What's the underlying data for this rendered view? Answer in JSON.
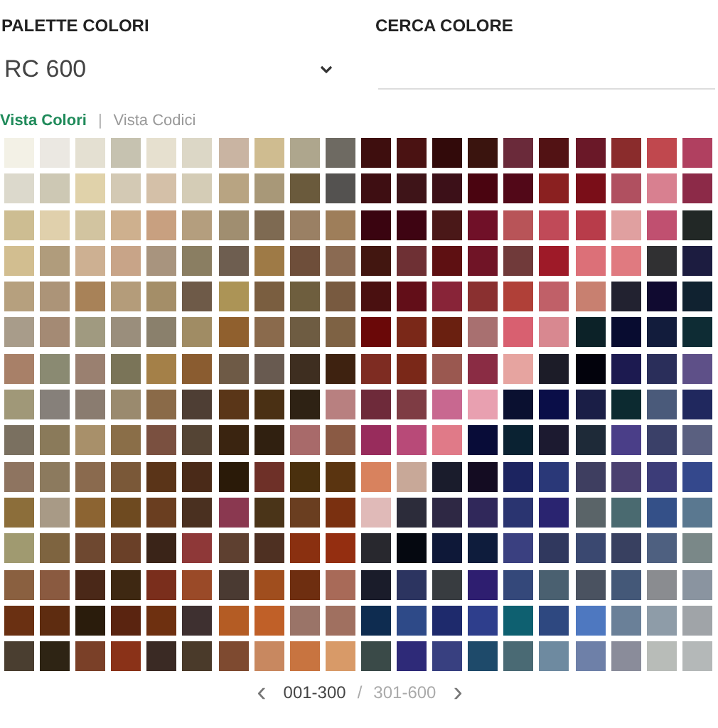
{
  "palette": {
    "label": "PALETTE COLORI",
    "value": "RC 600"
  },
  "search": {
    "label": "CERCA COLORE"
  },
  "views": [
    {
      "label": "Vista Colori",
      "selected": true
    },
    {
      "label": "Vista Codici",
      "selected": false
    }
  ],
  "view_separator": "|",
  "rows": [
    {
      "swatches": [
        {
          "color": "#f3f1e6"
        },
        {
          "color": "#ebe8e2"
        },
        {
          "color": "#e4e0d2"
        },
        {
          "color": "#c6c2b0"
        },
        {
          "color": "#e6e0cf"
        },
        {
          "color": "#dcd7c6"
        },
        {
          "color": "#c9b4a2"
        },
        {
          "color": "#cfbc90"
        },
        {
          "color": "#aea68d"
        },
        {
          "color": "#6e6a62"
        },
        {
          "color": "#3e0e0e"
        },
        {
          "color": "#4a1212"
        },
        {
          "color": "#320a0a"
        },
        {
          "color": "#3a140e"
        },
        {
          "color": "#6a2a3a"
        },
        {
          "color": "#521214"
        },
        {
          "color": "#6a1828"
        },
        {
          "color": "#8a2c2c"
        },
        {
          "color": "#c0484e"
        },
        {
          "color": "#b04060"
        }
      ]
    },
    {
      "swatches": [
        {
          "color": "#dcd9cc"
        },
        {
          "color": "#cdc8b4"
        },
        {
          "color": "#e0d2aa"
        },
        {
          "color": "#d3c9b4"
        },
        {
          "color": "#d4c0a8"
        },
        {
          "color": "#d4ccb6"
        },
        {
          "color": "#b8a482"
        },
        {
          "color": "#a89878"
        },
        {
          "color": "#6a5a3c"
        },
        {
          "color": "#545250"
        },
        {
          "color": "#3e0e12"
        },
        {
          "color": "#3e1418"
        },
        {
          "color": "#3c1018"
        },
        {
          "color": "#4a0410"
        },
        {
          "color": "#520818"
        },
        {
          "color": "#8a2020"
        },
        {
          "color": "#7a0e18"
        },
        {
          "color": "#b05060"
        },
        {
          "color": "#d88090"
        },
        {
          "color": "#8c2a48"
        }
      ]
    },
    {
      "swatches": [
        {
          "color": "#cdbd92"
        },
        {
          "color": "#e0d0ac"
        },
        {
          "color": "#d2c4a0"
        },
        {
          "color": "#ceb08e"
        },
        {
          "color": "#c8a080"
        },
        {
          "color": "#b49e7e"
        },
        {
          "color": "#a08e70"
        },
        {
          "color": "#7e6a52"
        },
        {
          "color": "#9a8064"
        },
        {
          "color": "#9e7e5a"
        },
        {
          "color": "#3a0410"
        },
        {
          "color": "#3e0412"
        },
        {
          "color": "#4a1818"
        },
        {
          "color": "#701028"
        },
        {
          "color": "#b85458"
        },
        {
          "color": "#c04a58"
        },
        {
          "color": "#b83c4a"
        },
        {
          "color": "#e0a0a0"
        },
        {
          "color": "#c05070"
        },
        {
          "color": "#222826"
        }
      ]
    },
    {
      "swatches": [
        {
          "color": "#d2be90"
        },
        {
          "color": "#b09c7c"
        },
        {
          "color": "#cdb092"
        },
        {
          "color": "#c8a488"
        },
        {
          "color": "#a8947e"
        },
        {
          "color": "#8a7e62"
        },
        {
          "color": "#6e5e50"
        },
        {
          "color": "#9e7a46"
        },
        {
          "color": "#6e4e3a"
        },
        {
          "color": "#8a6a52"
        },
        {
          "color": "#421610"
        },
        {
          "color": "#6e3034"
        },
        {
          "color": "#5e1012"
        },
        {
          "color": "#701426"
        },
        {
          "color": "#703a3a"
        },
        {
          "color": "#9e1a28"
        },
        {
          "color": "#dc7078"
        },
        {
          "color": "#e07a80"
        },
        {
          "color": "#303032"
        },
        {
          "color": "#1c1c40"
        }
      ]
    },
    {
      "swatches": [
        {
          "color": "#b6a07e"
        },
        {
          "color": "#ac9478"
        },
        {
          "color": "#a88258"
        },
        {
          "color": "#b49c7a"
        },
        {
          "color": "#a48e68"
        },
        {
          "color": "#6e5a48"
        },
        {
          "color": "#ac9456"
        },
        {
          "color": "#7a5e40"
        },
        {
          "color": "#6e5e3e"
        },
        {
          "color": "#785a40"
        },
        {
          "color": "#4a1010"
        },
        {
          "color": "#620e18"
        },
        {
          "color": "#882438"
        },
        {
          "color": "#8a3030"
        },
        {
          "color": "#b04038"
        },
        {
          "color": "#c06068"
        },
        {
          "color": "#c88070"
        },
        {
          "color": "#222230"
        },
        {
          "color": "#100a30"
        },
        {
          "color": "#102230"
        }
      ]
    },
    {
      "swatches": [
        {
          "color": "#a89c8a"
        },
        {
          "color": "#a48a74"
        },
        {
          "color": "#a09a80"
        },
        {
          "color": "#9a8e7c"
        },
        {
          "color": "#8a806c"
        },
        {
          "color": "#a08c64"
        },
        {
          "color": "#90602e"
        },
        {
          "color": "#8a6a4c"
        },
        {
          "color": "#6e5c42"
        },
        {
          "color": "#7e6244"
        },
        {
          "color": "#6a0808"
        },
        {
          "color": "#7a2818"
        },
        {
          "color": "#6a2010"
        },
        {
          "color": "#a87070"
        },
        {
          "color": "#d86070"
        },
        {
          "color": "#d88890"
        },
        {
          "color": "#0c2228"
        },
        {
          "color": "#080c30"
        },
        {
          "color": "#121c3c"
        },
        {
          "color": "#0e2c34"
        }
      ]
    },
    {
      "swatches": [
        {
          "color": "#a88068"
        },
        {
          "color": "#8a8a72"
        },
        {
          "color": "#9a8070"
        },
        {
          "color": "#7a7458"
        },
        {
          "color": "#a48048"
        },
        {
          "color": "#8a5c30"
        },
        {
          "color": "#6e5a46"
        },
        {
          "color": "#685a50"
        },
        {
          "color": "#3e2e20"
        },
        {
          "color": "#3e2210"
        },
        {
          "color": "#7e2c22"
        },
        {
          "color": "#7a2818"
        },
        {
          "color": "#9a5850"
        },
        {
          "color": "#8a2c44"
        },
        {
          "color": "#e6a4a0"
        },
        {
          "color": "#1c1c28"
        },
        {
          "color": "#02020c"
        },
        {
          "color": "#1c1a50"
        },
        {
          "color": "#2a2e5a"
        },
        {
          "color": "#5e5088"
        }
      ]
    },
    {
      "swatches": [
        {
          "color": "#a09878"
        },
        {
          "color": "#86807a"
        },
        {
          "color": "#8a7c70"
        },
        {
          "color": "#9a8a6e"
        },
        {
          "color": "#8a6a48"
        },
        {
          "color": "#4e3e34"
        },
        {
          "color": "#5a3618"
        },
        {
          "color": "#4a3014"
        },
        {
          "color": "#2e2214"
        },
        {
          "color": "#b88080"
        },
        {
          "color": "#6e2a3a"
        },
        {
          "color": "#7e3c44"
        },
        {
          "color": "#c86890"
        },
        {
          "color": "#e8a0b0"
        },
        {
          "color": "#0a1030"
        },
        {
          "color": "#0a0e48"
        },
        {
          "color": "#1a1e46"
        },
        {
          "color": "#0c2a30"
        },
        {
          "color": "#4a5a7a"
        },
        {
          "color": "#20285e"
        }
      ]
    },
    {
      "swatches": [
        {
          "color": "#7a7060"
        },
        {
          "color": "#8a7a5a"
        },
        {
          "color": "#a8906a"
        },
        {
          "color": "#8a6e48"
        },
        {
          "color": "#7a5040"
        },
        {
          "color": "#544434"
        },
        {
          "color": "#3a2410"
        },
        {
          "color": "#302010"
        },
        {
          "color": "#a86a6a"
        },
        {
          "color": "#8a5a44"
        },
        {
          "color": "#982c5c"
        },
        {
          "color": "#b84a78"
        },
        {
          "color": "#e07a88"
        },
        {
          "color": "#080c38"
        },
        {
          "color": "#0a2232"
        },
        {
          "color": "#1c1a30"
        },
        {
          "color": "#1e2a38"
        },
        {
          "color": "#4a3e88"
        },
        {
          "color": "#3a4068"
        },
        {
          "color": "#5a6080"
        }
      ]
    },
    {
      "swatches": [
        {
          "color": "#8e7460"
        },
        {
          "color": "#8c7a5e"
        },
        {
          "color": "#8a6a4e"
        },
        {
          "color": "#7a5838"
        },
        {
          "color": "#5a3418"
        },
        {
          "color": "#4a2a18"
        },
        {
          "color": "#2a1a08"
        },
        {
          "color": "#6e3028"
        },
        {
          "color": "#4a300e"
        },
        {
          "color": "#5a3410"
        },
        {
          "color": "#d8825e"
        },
        {
          "color": "#c8a898"
        },
        {
          "color": "#1a1c2c"
        },
        {
          "color": "#140c22"
        },
        {
          "color": "#1c2460"
        },
        {
          "color": "#2a3878"
        },
        {
          "color": "#3e3e60"
        },
        {
          "color": "#4a4070"
        },
        {
          "color": "#3c3c78"
        },
        {
          "color": "#34488c"
        }
      ]
    },
    {
      "swatches": [
        {
          "color": "#8c6e3a"
        },
        {
          "color": "#a89a86"
        },
        {
          "color": "#8c6432"
        },
        {
          "color": "#6e4a20"
        },
        {
          "color": "#6a3e20"
        },
        {
          "color": "#4a3020"
        },
        {
          "color": "#8a3850"
        },
        {
          "color": "#4a3418"
        },
        {
          "color": "#6a3e20"
        },
        {
          "color": "#7a3010"
        },
        {
          "color": "#e0bab8"
        },
        {
          "color": "#2c2c3a"
        },
        {
          "color": "#2e2844"
        },
        {
          "color": "#30285a"
        },
        {
          "color": "#2a3470"
        },
        {
          "color": "#2a2470"
        },
        {
          "color": "#5a6468"
        },
        {
          "color": "#4a6a70"
        },
        {
          "color": "#345088"
        },
        {
          "color": "#5a7890"
        }
      ]
    },
    {
      "swatches": [
        {
          "color": "#a09a70"
        },
        {
          "color": "#7e6440"
        },
        {
          "color": "#6e4830"
        },
        {
          "color": "#6a4028"
        },
        {
          "color": "#3a2418"
        },
        {
          "color": "#8e3838"
        },
        {
          "color": "#5e4030"
        },
        {
          "color": "#4e3022"
        },
        {
          "color": "#8a3010"
        },
        {
          "color": "#942e10"
        },
        {
          "color": "#28282e"
        },
        {
          "color": "#050810"
        },
        {
          "color": "#0e1838"
        },
        {
          "color": "#0e1c3c"
        },
        {
          "color": "#3a4080"
        },
        {
          "color": "#30385e"
        },
        {
          "color": "#3a4870"
        },
        {
          "color": "#384060"
        },
        {
          "color": "#4e6080"
        },
        {
          "color": "#7a8888"
        }
      ]
    },
    {
      "swatches": [
        {
          "color": "#8a6040"
        },
        {
          "color": "#8a5a40"
        },
        {
          "color": "#4a2818"
        },
        {
          "color": "#3e2812"
        },
        {
          "color": "#7a2e1c"
        },
        {
          "color": "#9a4a28"
        },
        {
          "color": "#4a3a32"
        },
        {
          "color": "#a04e1e"
        },
        {
          "color": "#6e2e10"
        },
        {
          "color": "#a86a58"
        },
        {
          "color": "#1a1c2a"
        },
        {
          "color": "#2c3460"
        },
        {
          "color": "#383c40"
        },
        {
          "color": "#2e1e70"
        },
        {
          "color": "#34487a"
        },
        {
          "color": "#4a6070"
        },
        {
          "color": "#4a5260"
        },
        {
          "color": "#445878"
        },
        {
          "color": "#8a8c90"
        },
        {
          "color": "#8a94a0"
        }
      ]
    },
    {
      "swatches": [
        {
          "color": "#6a3012"
        },
        {
          "color": "#5e2c10"
        },
        {
          "color": "#2a1c0c"
        },
        {
          "color": "#5a2410"
        },
        {
          "color": "#6e3010"
        },
        {
          "color": "#3e3030"
        },
        {
          "color": "#b45c24"
        },
        {
          "color": "#c06028"
        },
        {
          "color": "#9a7468"
        },
        {
          "color": "#a07060"
        },
        {
          "color": "#0e2c50"
        },
        {
          "color": "#2e4a88"
        },
        {
          "color": "#1e2a6c"
        },
        {
          "color": "#2e3e8c"
        },
        {
          "color": "#0e6070"
        },
        {
          "color": "#2e4880"
        },
        {
          "color": "#4e78c0"
        },
        {
          "color": "#6a8098"
        },
        {
          "color": "#8e9ca8"
        },
        {
          "color": "#a0a4a8"
        }
      ]
    },
    {
      "swatches": [
        {
          "color": "#4a3e30"
        },
        {
          "color": "#2e2414"
        },
        {
          "color": "#7a4028"
        },
        {
          "color": "#8a3218"
        },
        {
          "color": "#3a2a24"
        },
        {
          "color": "#4a3a2a"
        },
        {
          "color": "#7e4a30"
        },
        {
          "color": "#c88860"
        },
        {
          "color": "#c87440"
        },
        {
          "color": "#d89a68"
        },
        {
          "color": "#3a4a48"
        },
        {
          "color": "#2e2a78"
        },
        {
          "color": "#384080"
        },
        {
          "color": "#1e4a6a"
        },
        {
          "color": "#4a6a74"
        },
        {
          "color": "#6e8aa0"
        },
        {
          "color": "#6e80a8"
        },
        {
          "color": "#8a8c9a"
        },
        {
          "color": "#b8bcb8"
        },
        {
          "color": "#b4b8b8"
        }
      ]
    }
  ],
  "pagination": {
    "prev": "‹",
    "next": "›",
    "separator": "/",
    "pages": [
      {
        "label": "001-300",
        "selected": true
      },
      {
        "label": "301-600",
        "selected": false
      }
    ]
  }
}
